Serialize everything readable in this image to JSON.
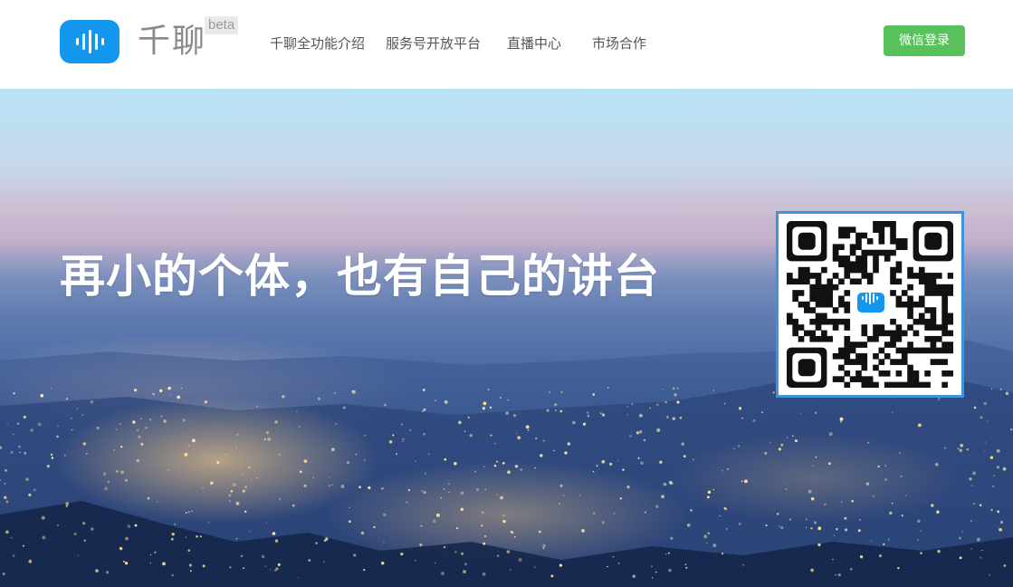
{
  "header": {
    "brand": "千聊",
    "badge": "beta",
    "logo_icon": "soundwave-icon",
    "nav": [
      "千聊全功能介绍",
      "服务号开放平台",
      "直播中心",
      "市场合作"
    ],
    "login_button": "微信登录"
  },
  "hero": {
    "title": "再小的个体，也有自己的讲台",
    "qr_icon": "qr-code-icon"
  },
  "colors": {
    "brand_blue": "#1296ee",
    "login_green": "#58c15b",
    "qr_border": "#3e93da"
  }
}
